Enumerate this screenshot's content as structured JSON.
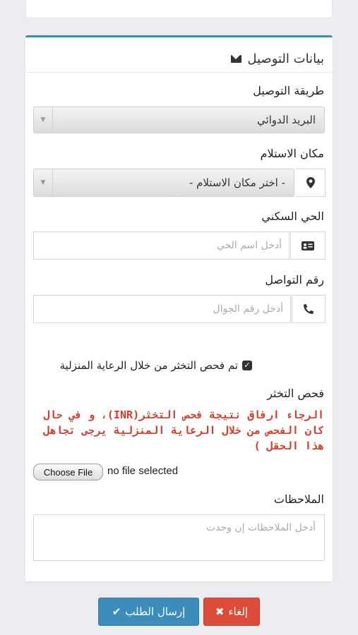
{
  "delivery": {
    "title": "بيانات التوصيل",
    "method": {
      "label": "طريقة التوصيل",
      "value": "البريد الدوائي"
    },
    "pickup": {
      "label": "مكان الاستلام",
      "value": "- اختر مكان الاستلام -"
    },
    "district": {
      "label": "الحي السكني",
      "placeholder": "أدخل اسم الحي"
    },
    "phone": {
      "label": "رقم التواصل",
      "placeholder": "أدخل رقم الجوال"
    },
    "home_care_check": {
      "label": "تم فحص التخثر من خلال الرعاية المنزلية",
      "checked": true
    },
    "coag_test": {
      "label": "فحص التخثر",
      "warning_lines": [
        "الرجاء ارفاق نتيجة فحص التخثر(INR)، و في حال",
        "كان الفحص من خلال الرعاية المنزلية يرجى تجاهل",
        "هذا الحقل )"
      ],
      "file_button": "Choose File",
      "file_status": "no file selected"
    },
    "notes": {
      "label": "الملاحظات",
      "placeholder": "أدخل الملاحظات إن وجدت"
    }
  },
  "actions": {
    "submit_label": "إرسال الطلب",
    "cancel_label": "إلغاء"
  },
  "colors": {
    "primary": "#3c8dbc",
    "danger": "#dd4b39",
    "warning_text": "#d73925"
  }
}
